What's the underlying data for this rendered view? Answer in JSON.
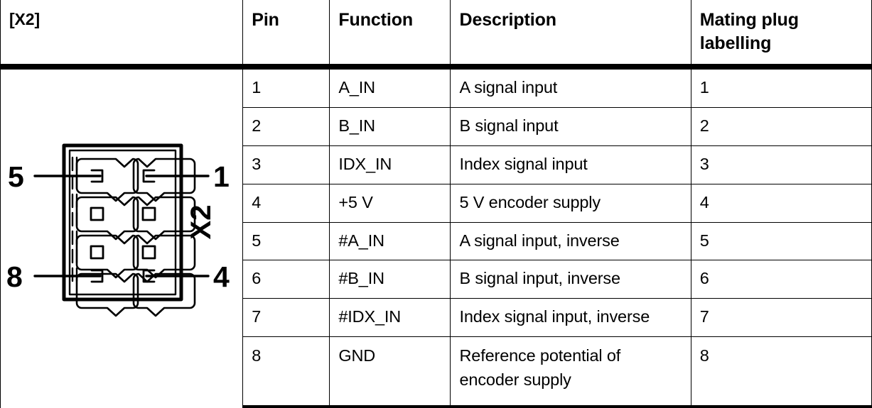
{
  "connector": {
    "tag": "[X2]",
    "side_label": "X2",
    "corner_labels": {
      "top_left": "5",
      "top_right": "1",
      "bottom_left": "8",
      "bottom_right": "4"
    },
    "pin_count": 8,
    "rows": 4,
    "columns": 2
  },
  "table": {
    "headers": {
      "diagram": "[X2]",
      "pin": "Pin",
      "function": "Function",
      "description": "Description",
      "mating": "Mating plug\nlabelling"
    },
    "rows": [
      {
        "pin": "1",
        "function": "A_IN",
        "description": "A signal input",
        "mating": "1"
      },
      {
        "pin": "2",
        "function": "B_IN",
        "description": "B signal input",
        "mating": "2"
      },
      {
        "pin": "3",
        "function": "IDX_IN",
        "description": "Index signal input",
        "mating": "3"
      },
      {
        "pin": "4",
        "function": "+5 V",
        "description": "5 V encoder supply",
        "mating": "4"
      },
      {
        "pin": "5",
        "function": "#A_IN",
        "description": "A signal input, inverse",
        "mating": "5"
      },
      {
        "pin": "6",
        "function": "#B_IN",
        "description": "B signal input, inverse",
        "mating": "6"
      },
      {
        "pin": "7",
        "function": "#IDX_IN",
        "description": "Index signal input, inverse",
        "mating": "7"
      },
      {
        "pin": "8",
        "function": "GND",
        "description": "Reference potential of\nencoder supply",
        "mating": "8"
      }
    ]
  },
  "colors": {
    "ink": "#000000",
    "paper": "#ffffff"
  }
}
